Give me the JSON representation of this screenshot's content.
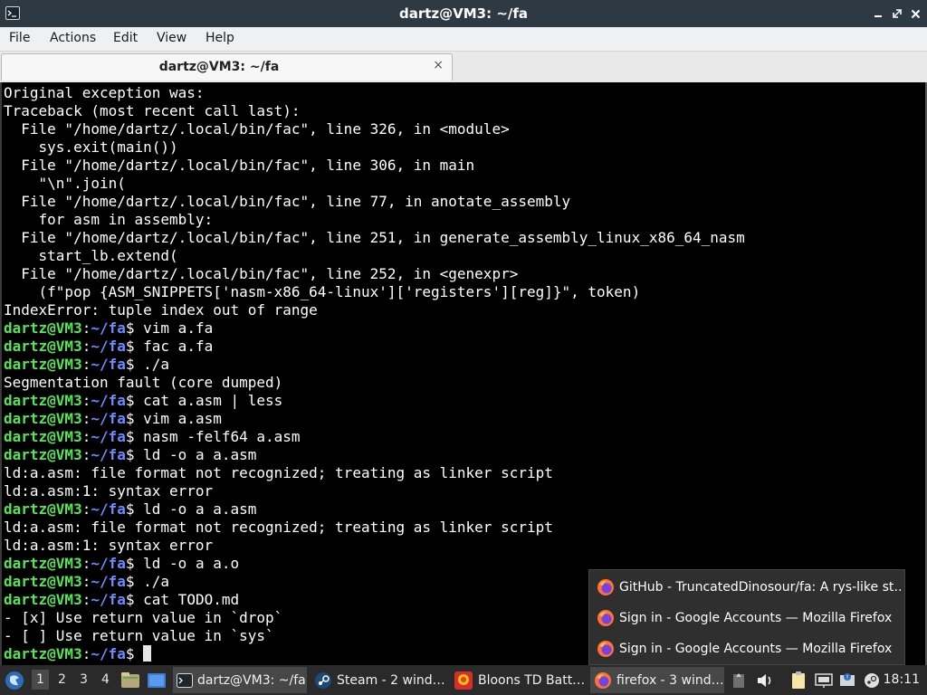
{
  "window": {
    "title": "dartz@VM3: ~/fa"
  },
  "menubar": {
    "items": [
      "File",
      "Actions",
      "Edit",
      "View",
      "Help"
    ]
  },
  "tab": {
    "label": "dartz@VM3: ~/fa",
    "close_glyph": "×"
  },
  "terminal": {
    "prompt_user": "dartz@VM3",
    "prompt_path": "~/fa",
    "lines": [
      {
        "type": "out",
        "text": "Original exception was:"
      },
      {
        "type": "out",
        "text": "Traceback (most recent call last):"
      },
      {
        "type": "out",
        "text": "  File \"/home/dartz/.local/bin/fac\", line 326, in <module>"
      },
      {
        "type": "out",
        "text": "    sys.exit(main())"
      },
      {
        "type": "out",
        "text": "  File \"/home/dartz/.local/bin/fac\", line 306, in main"
      },
      {
        "type": "out",
        "text": "    \"\\n\".join("
      },
      {
        "type": "out",
        "text": "  File \"/home/dartz/.local/bin/fac\", line 77, in anotate_assembly"
      },
      {
        "type": "out",
        "text": "    for asm in assembly:"
      },
      {
        "type": "out",
        "text": "  File \"/home/dartz/.local/bin/fac\", line 251, in generate_assembly_linux_x86_64_nasm"
      },
      {
        "type": "out",
        "text": "    start_lb.extend("
      },
      {
        "type": "out",
        "text": "  File \"/home/dartz/.local/bin/fac\", line 252, in <genexpr>"
      },
      {
        "type": "out",
        "text": "    (f\"pop {ASM_SNIPPETS['nasm-x86_64-linux']['registers'][reg]}\", token)"
      },
      {
        "type": "out",
        "text": "IndexError: tuple index out of range"
      },
      {
        "type": "cmd",
        "text": " vim a.fa"
      },
      {
        "type": "cmd",
        "text": " fac a.fa"
      },
      {
        "type": "cmd",
        "text": " ./a"
      },
      {
        "type": "out",
        "text": "Segmentation fault (core dumped)"
      },
      {
        "type": "cmd",
        "text": " cat a.asm | less"
      },
      {
        "type": "cmd",
        "text": " vim a.asm"
      },
      {
        "type": "cmd",
        "text": " nasm -felf64 a.asm"
      },
      {
        "type": "cmd",
        "text": " ld -o a a.asm"
      },
      {
        "type": "out",
        "text": "ld:a.asm: file format not recognized; treating as linker script"
      },
      {
        "type": "out",
        "text": "ld:a.asm:1: syntax error"
      },
      {
        "type": "cmd",
        "text": " ld -o a a.asm"
      },
      {
        "type": "out",
        "text": "ld:a.asm: file format not recognized; treating as linker script"
      },
      {
        "type": "out",
        "text": "ld:a.asm:1: syntax error"
      },
      {
        "type": "cmd",
        "text": " ld -o a a.o"
      },
      {
        "type": "cmd",
        "text": " ./a"
      },
      {
        "type": "cmd",
        "text": " cat TODO.md"
      },
      {
        "type": "out",
        "text": "- [x] Use return value in `drop`"
      },
      {
        "type": "out",
        "text": "- [ ] Use return value in `sys`"
      },
      {
        "type": "cmd",
        "text": " ",
        "cursor": true
      }
    ]
  },
  "popup": {
    "items": [
      "GitHub - TruncatedDinosour/fa: A rys-like st…",
      "Sign in - Google Accounts — Mozilla Firefox",
      "Sign in - Google Accounts — Mozilla Firefox"
    ]
  },
  "taskbar": {
    "workspaces": [
      "1",
      "2",
      "3",
      "4"
    ],
    "tasks": [
      "dartz@VM3: ~/fa",
      "Steam - 2 wind…",
      "Bloons TD Batt…",
      "firefox - 3 wind…"
    ],
    "clock": "18:11"
  },
  "colors": {
    "prompt_user": "#55e655",
    "prompt_path": "#6b8cff",
    "terminal_bg": "#000000",
    "taskbar_bg": "#2a2a2a"
  }
}
